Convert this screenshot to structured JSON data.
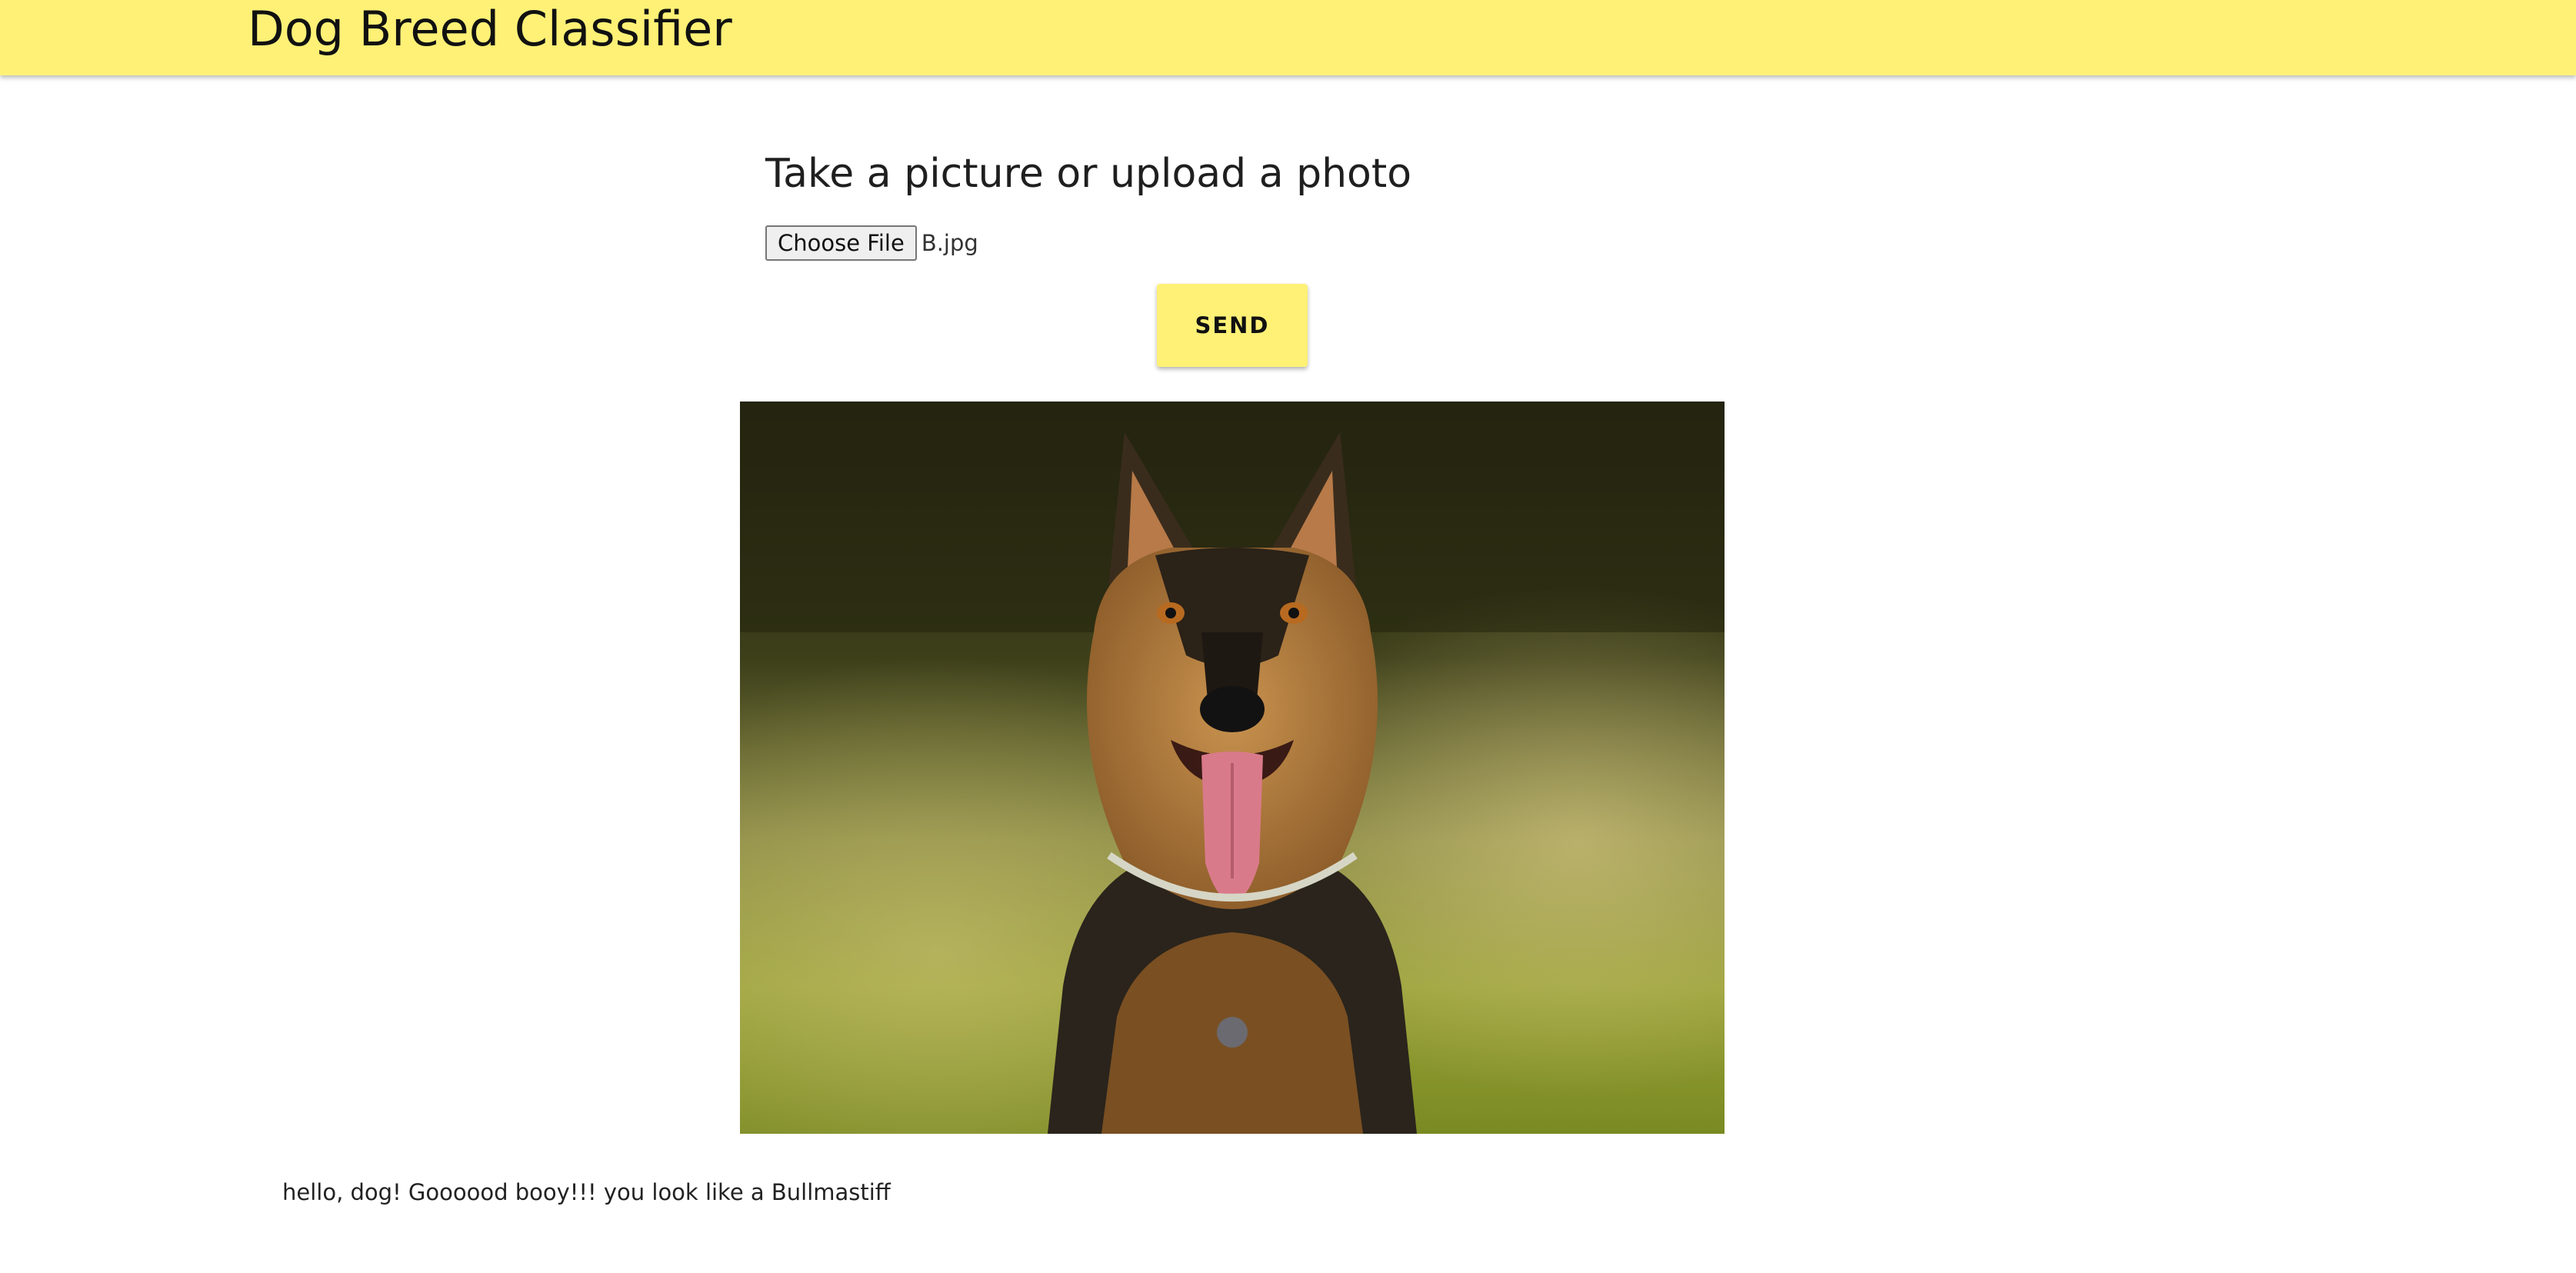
{
  "header": {
    "title": "Dog Breed Classifier",
    "bar_color": "#fff176"
  },
  "form": {
    "heading": "Take a picture or upload a photo",
    "file_button_label": "Choose File",
    "file_name": "B.jpg",
    "send_label": "SEND"
  },
  "preview": {
    "alt": "uploaded dog photo"
  },
  "result": {
    "message": "hello, dog! Goooood booy!!! you look like a Bullmastiff"
  }
}
